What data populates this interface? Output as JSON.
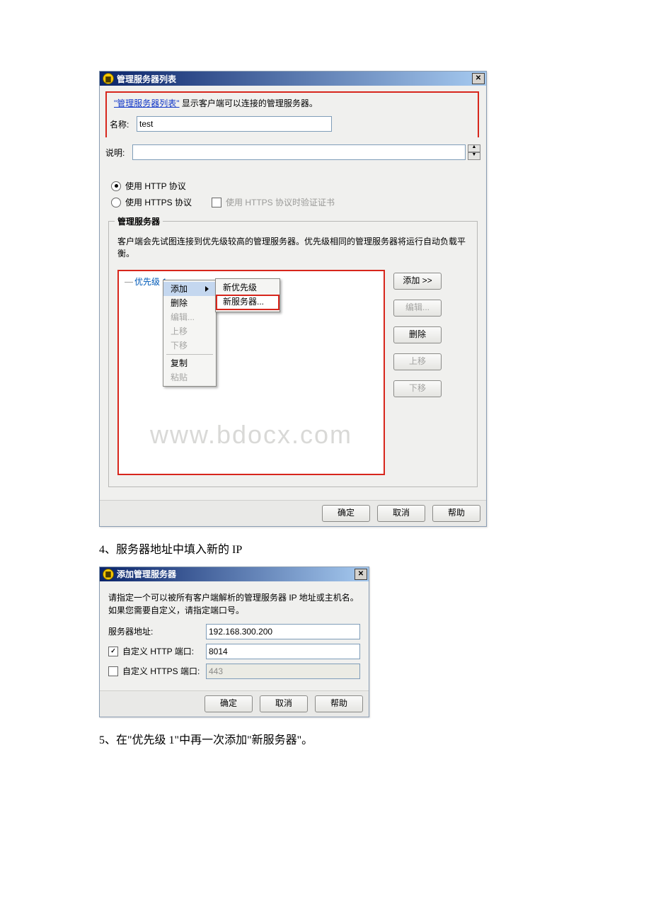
{
  "dialog1": {
    "title": "管理服务器列表",
    "hint_quoted": "\"管理服务器列表\"",
    "hint_suffix": "显示客户端可以连接的管理服务器。",
    "label_name": "名称:",
    "value_name": "test",
    "label_desc": "说明:",
    "value_desc": "",
    "radio_http": "使用 HTTP 协议",
    "radio_https": "使用 HTTPS 协议",
    "check_verify": "使用 HTTPS 协议时验证证书",
    "group_title": "管理服务器",
    "group_hint": "客户端会先试图连接到优先级较高的管理服务器。优先级相同的管理服务器将运行自动负载平衡。",
    "tree_priority1": "优先级 1",
    "ctx_add": "添加",
    "ctx_delete": "删除",
    "ctx_edit": "编辑...",
    "ctx_up": "上移",
    "ctx_down": "下移",
    "ctx_copy": "复制",
    "ctx_paste": "粘贴",
    "sub_newpriority": "新优先级",
    "sub_newserver": "新服务器...",
    "btn_add": "添加 >>",
    "btn_edit": "编辑...",
    "btn_delete": "删除",
    "btn_up": "上移",
    "btn_down": "下移",
    "watermark": "www.bdocx.com",
    "btn_ok": "确定",
    "btn_cancel": "取消",
    "btn_help": "帮助"
  },
  "doc": {
    "step4": "4、服务器地址中填入新的 IP",
    "step5": "5、在\"优先级 1\"中再一次添加\"新服务器\"。"
  },
  "dialog2": {
    "title": "添加管理服务器",
    "hint": "请指定一个可以被所有客户端解析的管理服务器 IP 地址或主机名。如果您需要自定义，请指定端口号。",
    "label_addr": "服务器地址:",
    "value_addr": "192.168.300.200",
    "check_http": "自定义 HTTP 端口:",
    "value_http": "8014",
    "check_https": "自定义 HTTPS 端口:",
    "value_https": "443",
    "btn_ok": "确定",
    "btn_cancel": "取消",
    "btn_help": "帮助"
  }
}
